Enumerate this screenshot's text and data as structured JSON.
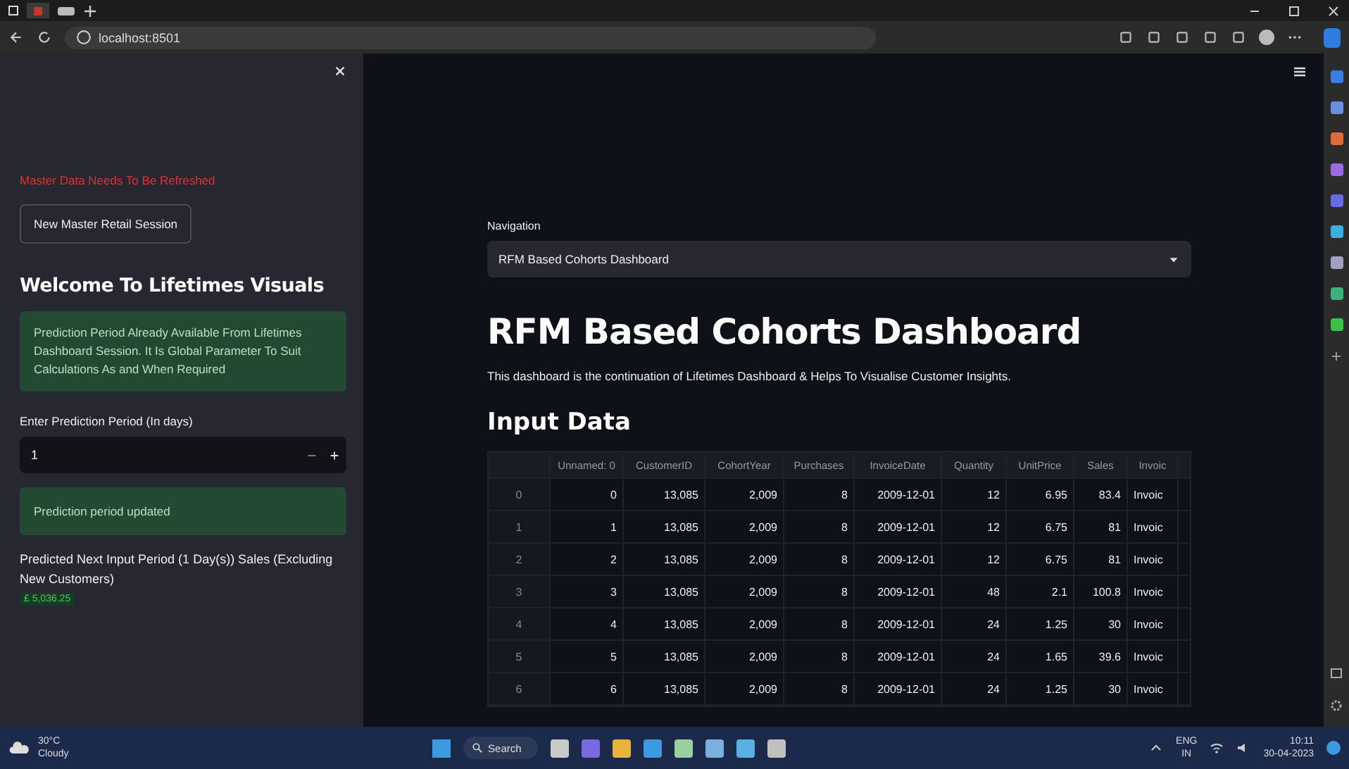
{
  "browser": {
    "address": "localhost:8501"
  },
  "sidebar": {
    "warning": "Master Data Needs To Be Refreshed",
    "button": "New Master Retail Session",
    "heading": "Welcome To Lifetimes Visuals",
    "info": "Prediction Period Already Available From Lifetimes Dashboard Session. It Is Global Parameter To Suit Calculations As and When Required",
    "input_label": "Enter Prediction Period (In days)",
    "input_value": "1",
    "success": "Prediction period updated",
    "metric_label": "Predicted Next Input Period (1 Day(s)) Sales (Excluding New Customers)",
    "metric_value": "£ 5,036.25"
  },
  "main": {
    "nav_label": "Navigation",
    "nav_value": "RFM Based Cohorts Dashboard",
    "title": "RFM Based Cohorts Dashboard",
    "description": "This dashboard is the continuation of Lifetimes Dashboard & Helps To Visualise Customer Insights.",
    "section": "Input Data",
    "table": {
      "columns": [
        "Unnamed: 0",
        "CustomerID",
        "CohortYear",
        "Purchases",
        "InvoiceDate",
        "Quantity",
        "UnitPrice",
        "Sales",
        "Invoic"
      ],
      "rows": [
        {
          "index": "0",
          "cells": [
            "0",
            "13,085",
            "2,009",
            "8",
            "2009-12-01",
            "12",
            "6.95",
            "83.4",
            "Invoic"
          ]
        },
        {
          "index": "1",
          "cells": [
            "1",
            "13,085",
            "2,009",
            "8",
            "2009-12-01",
            "12",
            "6.75",
            "81",
            "Invoic"
          ]
        },
        {
          "index": "2",
          "cells": [
            "2",
            "13,085",
            "2,009",
            "8",
            "2009-12-01",
            "12",
            "6.75",
            "81",
            "Invoic"
          ]
        },
        {
          "index": "3",
          "cells": [
            "3",
            "13,085",
            "2,009",
            "8",
            "2009-12-01",
            "48",
            "2.1",
            "100.8",
            "Invoic"
          ]
        },
        {
          "index": "4",
          "cells": [
            "4",
            "13,085",
            "2,009",
            "8",
            "2009-12-01",
            "24",
            "1.25",
            "30",
            "Invoic"
          ]
        },
        {
          "index": "5",
          "cells": [
            "5",
            "13,085",
            "2,009",
            "8",
            "2009-12-01",
            "24",
            "1.65",
            "39.6",
            "Invoic"
          ]
        },
        {
          "index": "6",
          "cells": [
            "6",
            "13,085",
            "2,009",
            "8",
            "2009-12-01",
            "24",
            "1.25",
            "30",
            "Invoic"
          ]
        }
      ]
    }
  },
  "taskbar": {
    "weather_temp": "30°C",
    "weather_desc": "Cloudy",
    "search": "Search",
    "lang_top": "ENG",
    "lang_bottom": "IN",
    "time": "10:11",
    "date": "30-04-2023"
  }
}
